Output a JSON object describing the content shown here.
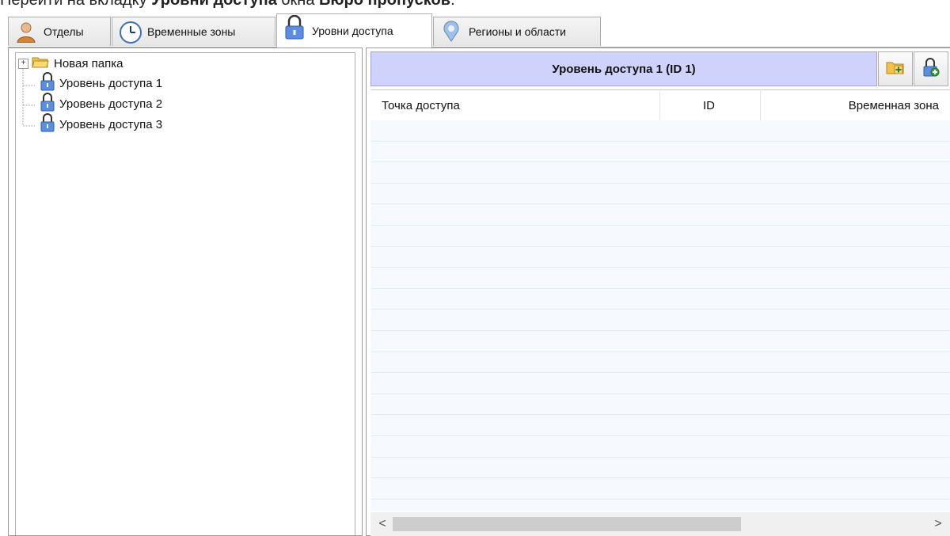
{
  "intro": {
    "prefix": "Перейти на вкладку ",
    "tab_bold": "Уровни доступа",
    "middle": " окна ",
    "window_bold": "Бюро пропусков",
    "suffix": "."
  },
  "tabs": [
    {
      "label": "Отделы",
      "icon": "person-icon",
      "active": false
    },
    {
      "label": "Временные зоны",
      "icon": "clock-icon",
      "active": false
    },
    {
      "label": "Уровни доступа",
      "icon": "padlock-icon",
      "active": true
    },
    {
      "label": "Регионы и области",
      "icon": "map-pin-icon",
      "active": false
    }
  ],
  "tree": {
    "items": [
      {
        "label": "Новая папка",
        "icon": "folder-icon",
        "expander": "⊞"
      },
      {
        "label": "Уровень доступа 1",
        "icon": "padlock-icon"
      },
      {
        "label": "Уровень доступа 2",
        "icon": "padlock-icon"
      },
      {
        "label": "Уровень доступа 3",
        "icon": "padlock-icon"
      }
    ]
  },
  "detail": {
    "title": "Уровень доступа 1 (ID 1)",
    "add_folder_icon": "add-folder-icon",
    "add_level_icon": "add-access-level-icon",
    "columns": [
      "Точка доступа",
      "ID",
      "Временная зона"
    ],
    "rows": [],
    "scroll_left": "<",
    "scroll_right": ">"
  },
  "colors": {
    "header_bg": "#cfd2fb",
    "row_bg": "#f6faff",
    "padlock": "#5b8ee0",
    "folder": "#f4c24a"
  }
}
